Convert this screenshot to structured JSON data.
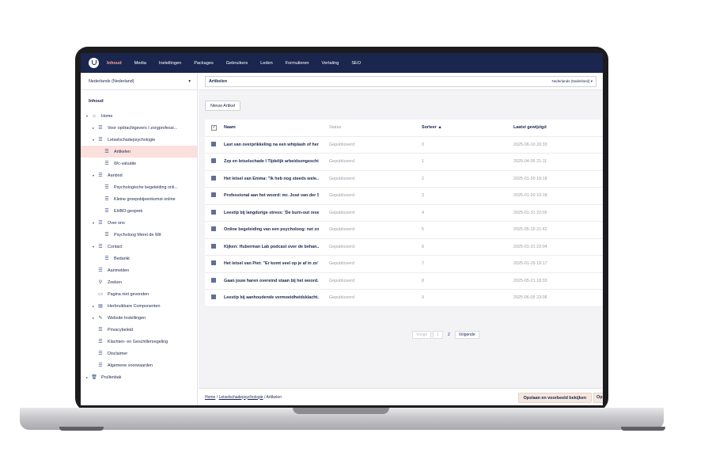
{
  "nav": {
    "items": [
      "Inhoud",
      "Media",
      "Instellingen",
      "Packages",
      "Gebruikers",
      "Leden",
      "Formulieren",
      "Vertaling",
      "SEO"
    ],
    "active": "Inhoud"
  },
  "sidebar": {
    "culture": "Nederlands (Nederland)",
    "section": "Inhoud",
    "tree": [
      {
        "label": "Home",
        "caret": "▾",
        "icon": "home-icon",
        "depth": 0
      },
      {
        "label": "Voor opdrachtgevers I zorgprofessi...",
        "caret": "▸",
        "icon": "doc-list-icon",
        "depth": 1
      },
      {
        "label": "Letselschadepsychologie",
        "caret": "▾",
        "icon": "doc-list-icon",
        "depth": 1
      },
      {
        "label": "Artikelen",
        "caret": "",
        "icon": "doc-list-icon",
        "depth": 2,
        "active": true
      },
      {
        "label": "Wc-valuatie",
        "caret": "",
        "icon": "doc-list-icon",
        "depth": 2
      },
      {
        "label": "Aanbod",
        "caret": "▾",
        "icon": "doc-list-icon",
        "depth": 1
      },
      {
        "label": "Psychologische begeleiding onli...",
        "caret": "",
        "icon": "doc-list-icon",
        "depth": 2
      },
      {
        "label": "Kleine groepsbijeenkomst online",
        "caret": "",
        "icon": "doc-list-icon",
        "depth": 2
      },
      {
        "label": "EHBO-gesprek",
        "caret": "",
        "icon": "doc-list-icon",
        "depth": 2
      },
      {
        "label": "Over ons",
        "caret": "▾",
        "icon": "doc-list-icon",
        "depth": 1
      },
      {
        "label": "Psycholoog Merel de Wit",
        "caret": "",
        "icon": "doc-list-icon",
        "depth": 2
      },
      {
        "label": "Contact",
        "caret": "▾",
        "icon": "doc-list-icon",
        "depth": 1
      },
      {
        "label": "Bedankt",
        "caret": "",
        "icon": "doc-list-icon",
        "depth": 2
      },
      {
        "label": "Aanmelden",
        "caret": "",
        "icon": "doc-list-icon",
        "depth": 1
      },
      {
        "label": "Zoeken",
        "caret": "",
        "icon": "search-icon",
        "depth": 1
      },
      {
        "label": "Pagina niet gevonden",
        "caret": "",
        "icon": "warning-icon",
        "depth": 1
      },
      {
        "label": "Herbruikbare Componenten",
        "caret": "▸",
        "icon": "stack-icon",
        "depth": 1
      },
      {
        "label": "Website Instellingen",
        "caret": "▸",
        "icon": "tools-icon",
        "depth": 1
      },
      {
        "label": "Privacybeleid",
        "caret": "",
        "icon": "doc-list-icon",
        "depth": 1
      },
      {
        "label": "Klachten- en Geschillenregeling",
        "caret": "",
        "icon": "doc-list-icon",
        "depth": 1
      },
      {
        "label": "Disclaimer",
        "caret": "",
        "icon": "doc-list-icon",
        "depth": 1
      },
      {
        "label": "Algemene voorwaarden",
        "caret": "",
        "icon": "doc-list-icon",
        "depth": 1
      },
      {
        "label": "Prullenbak",
        "caret": "▸",
        "icon": "trash-icon",
        "depth": 0
      }
    ]
  },
  "header": {
    "name": "Artikelen",
    "culture": "Nederlands (Nederland) ▾"
  },
  "main": {
    "new_button": "Nieuw Artikel",
    "columns": [
      "Naam",
      "Status",
      "Sorteer ▲",
      "Laatst gewijzigd"
    ],
    "rows": [
      {
        "name": "Last van overprikkeling na een whiplash of her...",
        "status": "Gepubliceerd",
        "sort": "0",
        "date": "2025-06-10 20:33"
      },
      {
        "name": "Zzp en letselschade I Tijdelijk arbeidsongeschikt",
        "status": "Gepubliceerd",
        "sort": "1",
        "date": "2025-04-05 21:11"
      },
      {
        "name": "Het letsel van Emma: \"Ik heb nog steeds wele...",
        "status": "Gepubliceerd",
        "sort": "2",
        "date": "2025-01-20 19:18"
      },
      {
        "name": "Professional aan het woord: mr. José van der S...",
        "status": "Gepubliceerd",
        "sort": "3",
        "date": "2025-01-20 19:18"
      },
      {
        "name": "Leestip bij langdurige stress: 'De burn-out reset'",
        "status": "Gepubliceerd",
        "sort": "4",
        "date": "2025-01-31 22:05"
      },
      {
        "name": "Online begeleiding van een psycholoog: net zo...",
        "status": "Gepubliceerd",
        "sort": "5",
        "date": "2025-05-15 21:42"
      },
      {
        "name": "Kijken: Huberman Lab podcast over de behan...",
        "status": "Gepubliceerd",
        "sort": "6",
        "date": "2025-01-31 22:04"
      },
      {
        "name": "Het letsel van Piet: \"Er komt veel op je af in zo'...",
        "status": "Gepubliceerd",
        "sort": "7",
        "date": "2025-01-29 18:17"
      },
      {
        "name": "Gaan jouw haren overeind staan bij het woord...",
        "status": "Gepubliceerd",
        "sort": "8",
        "date": "2025-05-21 18:33"
      },
      {
        "name": "Leestip bij aanhoudende vermoeidheidsklacht...",
        "status": "Gepubliceerd",
        "sort": "9",
        "date": "2025-06-05 23:06"
      }
    ],
    "pager": {
      "prev": "Vorige",
      "page1": "1",
      "page2": "2",
      "next": "Volgende"
    }
  },
  "footer": {
    "crumb1": "Home",
    "crumb2": "Letselschadepsychologie",
    "crumb3": "Artikelen",
    "save_label": "Opslaan en voorbeeld bekijken",
    "publish_label": "Op"
  }
}
